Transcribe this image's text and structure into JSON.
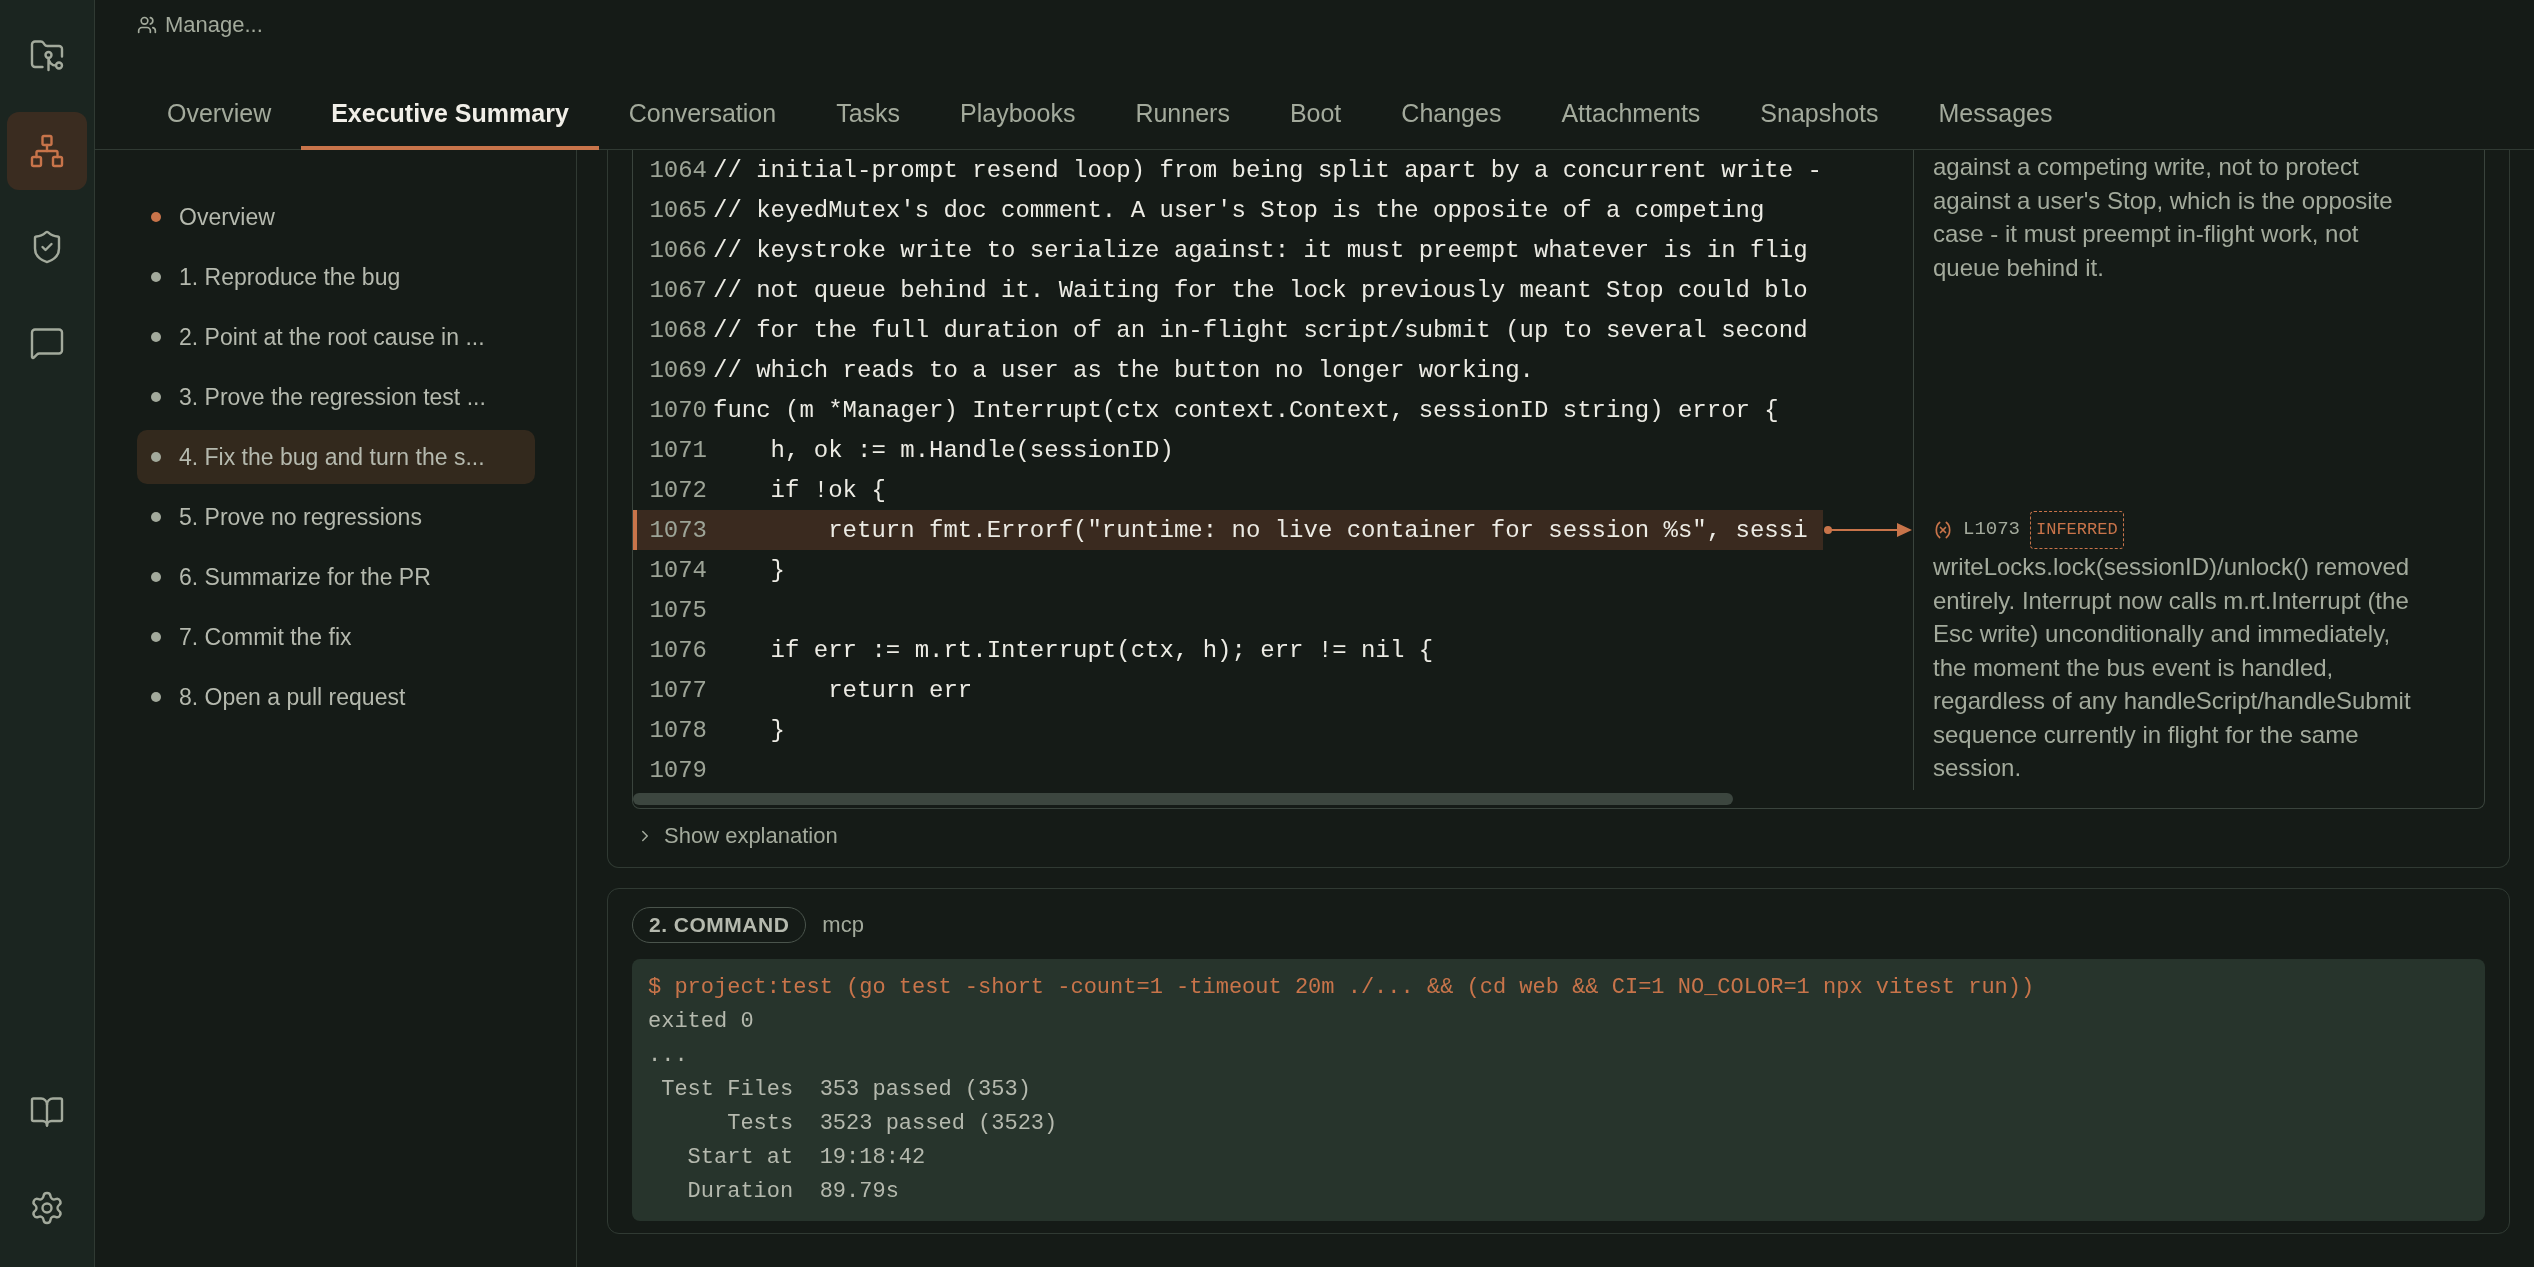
{
  "rail": {
    "top": [
      {
        "kind": "folder",
        "selected": false
      },
      {
        "kind": "network",
        "selected": true
      },
      {
        "kind": "shield",
        "selected": false
      },
      {
        "kind": "chat",
        "selected": false
      }
    ],
    "bottom": [
      {
        "kind": "book",
        "selected": false
      },
      {
        "kind": "settings",
        "selected": false
      }
    ]
  },
  "header": {
    "breadcrumb": "Manage..."
  },
  "tabs": [
    {
      "label": "Overview",
      "selected": false
    },
    {
      "label": "Executive Summary",
      "selected": true
    },
    {
      "label": "Conversation",
      "selected": false
    },
    {
      "label": "Tasks",
      "selected": false
    },
    {
      "label": "Playbooks",
      "selected": false
    },
    {
      "label": "Runners",
      "selected": false
    },
    {
      "label": "Boot",
      "selected": false
    },
    {
      "label": "Changes",
      "selected": false
    },
    {
      "label": "Attachments",
      "selected": false
    },
    {
      "label": "Snapshots",
      "selected": false
    },
    {
      "label": "Messages",
      "selected": false
    }
  ],
  "outline": [
    {
      "label": "Overview",
      "selected": false,
      "color": "#c8744a"
    },
    {
      "label": "1. Reproduce the bug",
      "selected": false,
      "color": "#a3aa9c"
    },
    {
      "label": "2. Point at the root cause in ...",
      "selected": false,
      "color": "#a3aa9c"
    },
    {
      "label": "3. Prove the regression test ...",
      "selected": false,
      "color": "#a3aa9c"
    },
    {
      "label": "4. Fix the bug and turn the s...",
      "selected": true,
      "color": "#a3aa9c"
    },
    {
      "label": "5. Prove no regressions",
      "selected": false,
      "color": "#a3aa9c"
    },
    {
      "label": "6. Summarize for the PR",
      "selected": false,
      "color": "#a3aa9c"
    },
    {
      "label": "7. Commit the fix",
      "selected": false,
      "color": "#a3aa9c"
    },
    {
      "label": "8. Open a pull request",
      "selected": false,
      "color": "#a3aa9c"
    }
  ],
  "code_block": {
    "lines": [
      {
        "number": "1064",
        "text": "// initial-prompt resend loop) from being split apart by a concurrent write -",
        "highlighted": false
      },
      {
        "number": "1065",
        "text": "// keyedMutex's doc comment. A user's Stop is the opposite of a competing",
        "highlighted": false
      },
      {
        "number": "1066",
        "text": "// keystroke write to serialize against: it must preempt whatever is in flig",
        "highlighted": false
      },
      {
        "number": "1067",
        "text": "// not queue behind it. Waiting for the lock previously meant Stop could blo",
        "highlighted": false
      },
      {
        "number": "1068",
        "text": "// for the full duration of an in-flight script/submit (up to several second",
        "highlighted": false
      },
      {
        "number": "1069",
        "text": "// which reads to a user as the button no longer working.",
        "highlighted": false
      },
      {
        "number": "1070",
        "text": "func (m *Manager) Interrupt(ctx context.Context, sessionID string) error {",
        "highlighted": false
      },
      {
        "number": "1071",
        "text": "    h, ok := m.Handle(sessionID)",
        "highlighted": false
      },
      {
        "number": "1072",
        "text": "    if !ok {",
        "highlighted": false
      },
      {
        "number": "1073",
        "text": "        return fmt.Errorf(\"runtime: no live container for session %s\", sessi",
        "highlighted": true
      },
      {
        "number": "1074",
        "text": "    }",
        "highlighted": false
      },
      {
        "number": "1075",
        "highlighted": false
      },
      {
        "number": "1076",
        "text": "    if err := m.rt.Interrupt(ctx, h); err != nil {",
        "highlighted": false
      },
      {
        "number": "1077",
        "text": "        return err",
        "highlighted": false
      },
      {
        "number": "1078",
        "text": "    }",
        "highlighted": false
      },
      {
        "number": "1079",
        "highlighted": false
      }
    ],
    "annotations": [
      {
        "text": "against a competing write, not to protect against a user's Stop, which is the opposite case - it must preempt in-flight work, not queue behind it."
      },
      {
        "line_ref": "L1073",
        "tag": "INFERRED",
        "text": "writeLocks.lock(sessionID)/unlock() removed entirely. Interrupt now calls m.rt.Interrupt (the Esc write) unconditionally and immediately, the moment the bus event is handled, regardless of any handleScript/handleSubmit sequence currently in flight for the same session."
      }
    ],
    "explanation_toggle": {
      "label": "Show explanation",
      "expanded": false
    }
  },
  "command": {
    "badge": "2. COMMAND",
    "source": "mcp",
    "output": [
      {
        "kind": "command",
        "text": "$ project:test (go test -short -count=1 -timeout 20m ./... && (cd web && CI=1 NO_COLOR=1 npx vitest run))"
      },
      {
        "kind": "plain",
        "text": "exited 0"
      },
      {
        "kind": "plain",
        "text": "..."
      },
      {
        "kind": "plain",
        "text": " Test Files  353 passed (353)"
      },
      {
        "kind": "plain",
        "text": "      Tests  3523 passed (3523)"
      },
      {
        "kind": "plain",
        "text": "   Start at  19:18:42"
      },
      {
        "kind": "plain",
        "text": "   Duration  89.79s"
      }
    ]
  }
}
